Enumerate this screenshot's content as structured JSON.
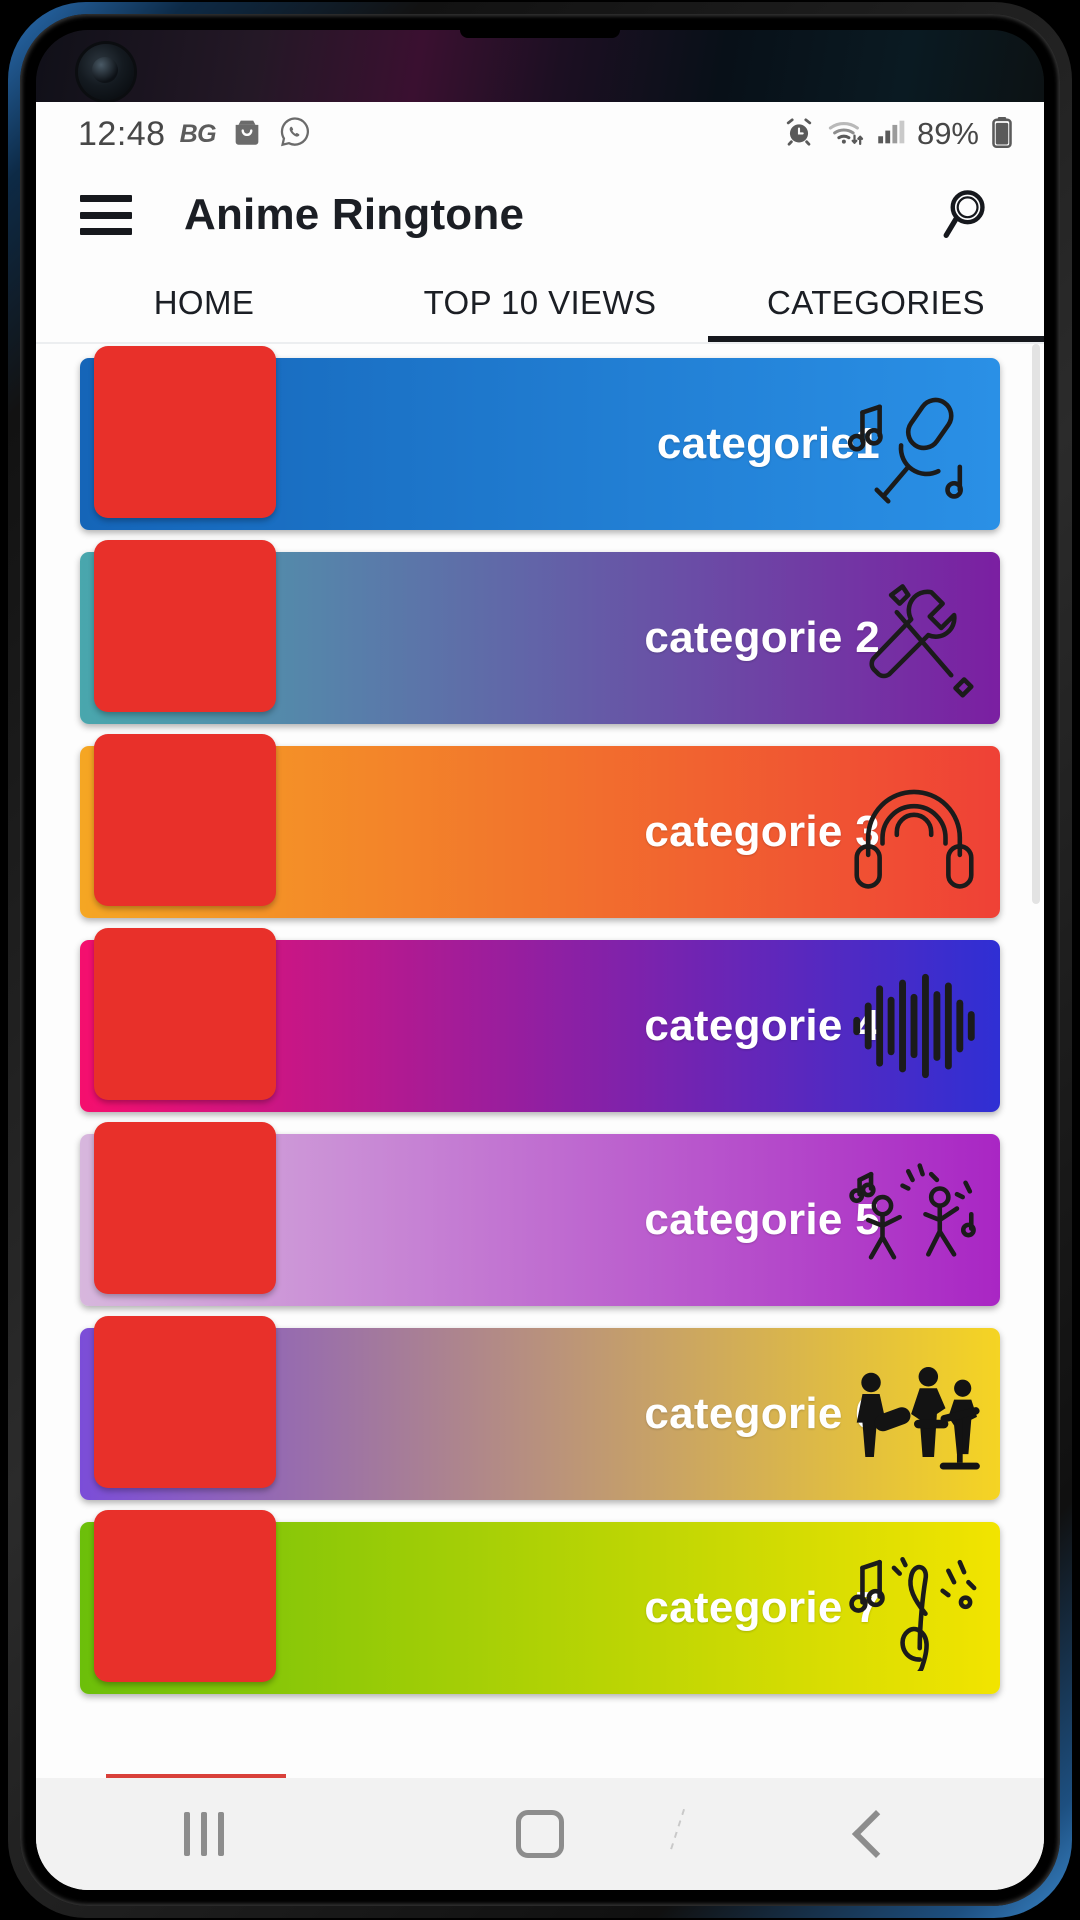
{
  "status_bar": {
    "time": "12:48",
    "carrier_label": "BG",
    "battery_percent": "89%",
    "icons": [
      "shopping-bag-icon",
      "whatsapp-icon",
      "alarm-icon",
      "wifi-icon",
      "signal-icon",
      "battery-icon"
    ]
  },
  "toolbar": {
    "menu_icon": "hamburger-menu-icon",
    "title": "Anime Ringtone",
    "search_icon": "search-icon"
  },
  "tabs": [
    {
      "label": "HOME",
      "active": false
    },
    {
      "label": "TOP 10 VIEWS",
      "active": false
    },
    {
      "label": "CATEGORIES",
      "active": true
    }
  ],
  "categories": [
    {
      "label": "categorie1",
      "icon": "microphone-music-icon",
      "gradient_from": "#1565b8",
      "gradient_to": "#2a90e6"
    },
    {
      "label": "categorie 2",
      "icon": "tools-wrench-pencil-icon",
      "gradient_from": "#49a7ad",
      "gradient_to": "#7b1fa2"
    },
    {
      "label": "categorie 3",
      "icon": "headphones-icon",
      "gradient_from": "#f5a623",
      "gradient_to": "#ef4136"
    },
    {
      "label": "categorie 4",
      "icon": "audio-waveform-icon",
      "gradient_from": "#f50f6e",
      "gradient_to": "#2f2fd4"
    },
    {
      "label": "categorie 5",
      "icon": "dancing-people-icon",
      "gradient_from": "#d7b7dd",
      "gradient_to": "#a926c4"
    },
    {
      "label": "categorie 6",
      "icon": "band-musicians-icon",
      "gradient_from": "#7b4dd8",
      "gradient_to": "#f5d423"
    },
    {
      "label": "categorie 7",
      "icon": "music-notes-clef-icon",
      "gradient_from": "#6cbf0a",
      "gradient_to": "#f2e400"
    }
  ],
  "thumbnail_color": "#e8302a",
  "navbar": {
    "recents_label": "recents-button",
    "home_label": "home-button",
    "back_label": "back-button"
  }
}
